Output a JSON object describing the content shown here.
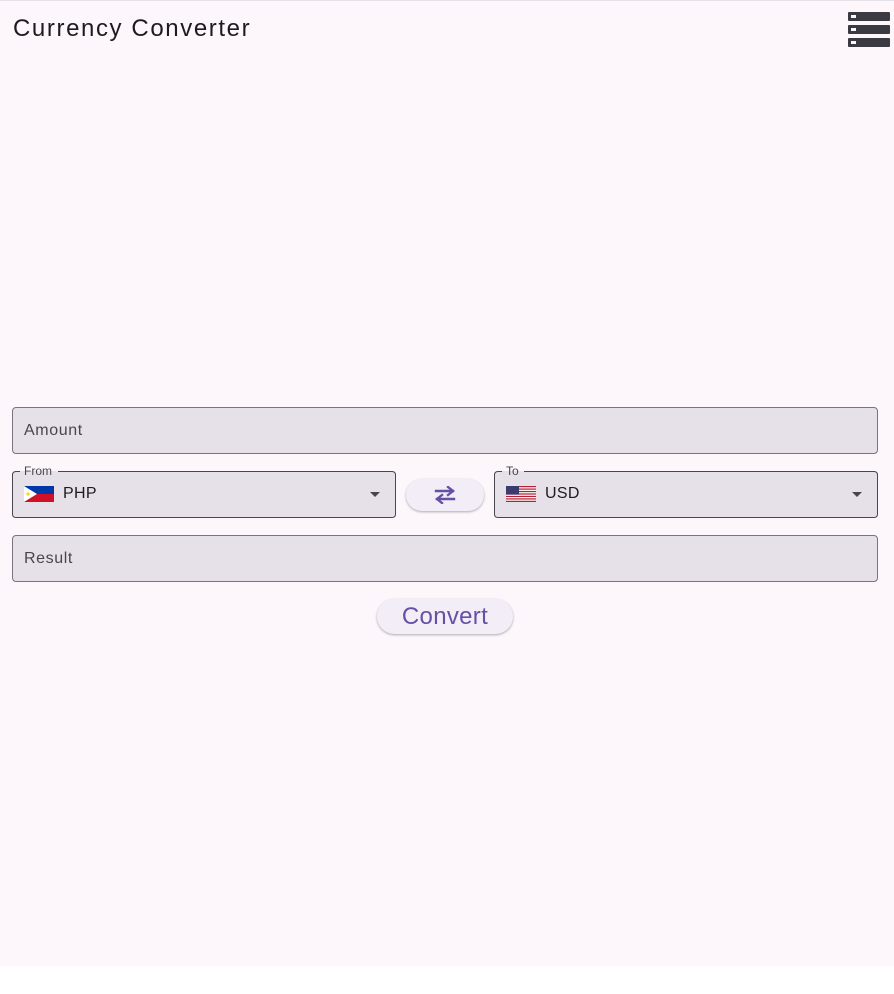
{
  "app": {
    "title": "Currency Converter",
    "menu_icon": "menu-storage-icon"
  },
  "form": {
    "amount": {
      "placeholder": "Amount",
      "value": ""
    },
    "from": {
      "label": "From",
      "code": "PHP",
      "flag": "philippines-flag-icon"
    },
    "to": {
      "label": "To",
      "code": "USD",
      "flag": "usa-flag-icon"
    },
    "swap_icon": "swap-arrows-icon",
    "result": {
      "placeholder": "Result",
      "value": ""
    },
    "convert_label": "Convert"
  },
  "colors": {
    "background": "#fdf7fb",
    "field_fill": "#e6e0e9",
    "field_border": "#79747e",
    "accent": "#6750a4",
    "button_fill": "#f3edf7"
  }
}
